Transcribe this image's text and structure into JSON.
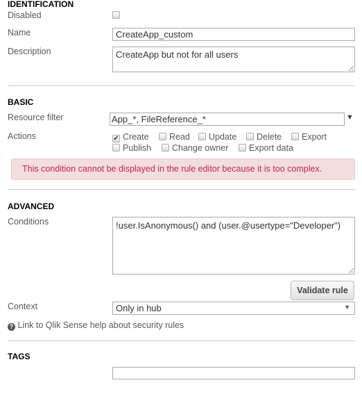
{
  "identification": {
    "heading": "IDENTIFICATION",
    "disabled_label": "Disabled",
    "disabled": false,
    "name_label": "Name",
    "name_value": "CreateApp_custom",
    "description_label": "Description",
    "description_value": "CreateApp but not for all users"
  },
  "basic": {
    "heading": "BASIC",
    "resource_filter_label": "Resource filter",
    "resource_filter_value": "App_*, FileReference_*",
    "actions_label": "Actions",
    "actions": [
      {
        "label": "Create",
        "checked": true
      },
      {
        "label": "Read",
        "checked": false
      },
      {
        "label": "Update",
        "checked": false
      },
      {
        "label": "Delete",
        "checked": false
      },
      {
        "label": "Export",
        "checked": false
      },
      {
        "label": "Publish",
        "checked": false
      },
      {
        "label": "Change owner",
        "checked": false
      },
      {
        "label": "Export data",
        "checked": false
      }
    ],
    "error": "This condition cannot be displayed in the rule editor because it is too complex.",
    "error_bg": "#f2dede",
    "error_color": "#c7254e"
  },
  "advanced": {
    "heading": "ADVANCED",
    "conditions_label": "Conditions",
    "conditions_value": "!user.IsAnonymous() and (user.@usertype=\"Developer\")",
    "validate_label": "Validate rule",
    "context_label": "Context",
    "context_value": "Only in hub",
    "help_link": "Link to Qlik Sense help about security rules"
  },
  "tags": {
    "heading": "TAGS",
    "value": ""
  }
}
